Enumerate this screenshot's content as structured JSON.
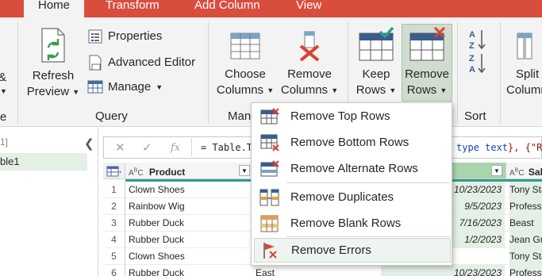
{
  "tabs": [
    {
      "label": "Home"
    },
    {
      "label": "Transform"
    },
    {
      "label": "Add Column"
    },
    {
      "label": "View"
    }
  ],
  "ribbon": {
    "partial_left_1": "&",
    "partial_left_2": "e",
    "refresh_label_1": "Refresh",
    "refresh_label_2": "Preview",
    "properties": "Properties",
    "advanced_editor": "Advanced Editor",
    "manage": "Manage",
    "query_group": "Query",
    "choose_label_1": "Choose",
    "choose_label_2": "Columns",
    "remove_cols_label_1": "Remove",
    "remove_cols_label_2": "Columns",
    "manage_group_partial": "Man",
    "keep_label_1": "Keep",
    "keep_label_2": "Rows",
    "remove_rows_label_1": "Remove",
    "remove_rows_label_2": "Rows",
    "sort_group": "Sort",
    "split_label_1": "Split",
    "split_label_2": "Column"
  },
  "query_pane": {
    "header": "1]",
    "item": "ble1"
  },
  "formula": {
    "text": "= Table.Tr",
    "tail_kw": "type text",
    "tail_rest": "}, {\"Re"
  },
  "grid": {
    "col1": "Product",
    "col4": "Sale",
    "rows": [
      {
        "n": "1",
        "product": "Clown Shoes",
        "c2": "",
        "date": "10/23/2023",
        "c4": "Tony Sta"
      },
      {
        "n": "2",
        "product": "Rainbow Wig",
        "c2": "",
        "date": "9/5/2023",
        "c4": "Professo"
      },
      {
        "n": "3",
        "product": "Rubber Duck",
        "c2": "",
        "date": "7/16/2023",
        "c4": "Beast"
      },
      {
        "n": "4",
        "product": "Rubber Duck",
        "c2": "",
        "date": "1/2/2023",
        "c4": "Jean Gre"
      },
      {
        "n": "5",
        "product": "Clown Shoes",
        "c2": "",
        "date": "",
        "c4": "Tony Sta"
      },
      {
        "n": "6",
        "product": "Rubber Duck",
        "c2": "East",
        "date": "10/23/2023",
        "c4": "Professo"
      }
    ]
  },
  "menu": {
    "items": [
      {
        "label": "Remove Top Rows"
      },
      {
        "label": "Remove Bottom Rows"
      },
      {
        "label": "Remove Alternate Rows"
      },
      {
        "label": "Remove Duplicates"
      },
      {
        "label": "Remove Blank Rows"
      },
      {
        "label": "Remove Errors"
      }
    ]
  },
  "colors": {
    "tab_bar": "#d94d3d",
    "accent_green": "#2e9e8d",
    "error_red": "#d9442f"
  }
}
